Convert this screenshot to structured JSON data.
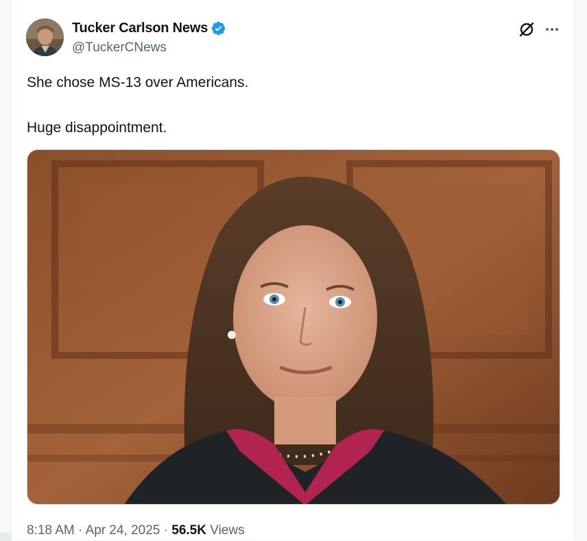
{
  "author": {
    "name": "Tucker Carlson News",
    "handle": "@TuckerCNews",
    "verified": true,
    "avatar_icon": "avatar-photo"
  },
  "header_icons": {
    "grok": "grok-icon",
    "more": "more-icon"
  },
  "tweet": {
    "lines": [
      "She chose MS-13 over Americans.",
      "Huge disappointment."
    ]
  },
  "media": {
    "type": "photo",
    "subject": "portrait-photo"
  },
  "meta": {
    "time": "8:18 AM",
    "separator1": "·",
    "date": "Apr 24, 2025",
    "separator2": "·",
    "views_count": "56.5K",
    "views_label": "Views"
  },
  "colors": {
    "text_primary": "#0f1419",
    "text_secondary": "#536471",
    "verified_blue": "#1d9bf0",
    "border": "#cfd9de"
  }
}
